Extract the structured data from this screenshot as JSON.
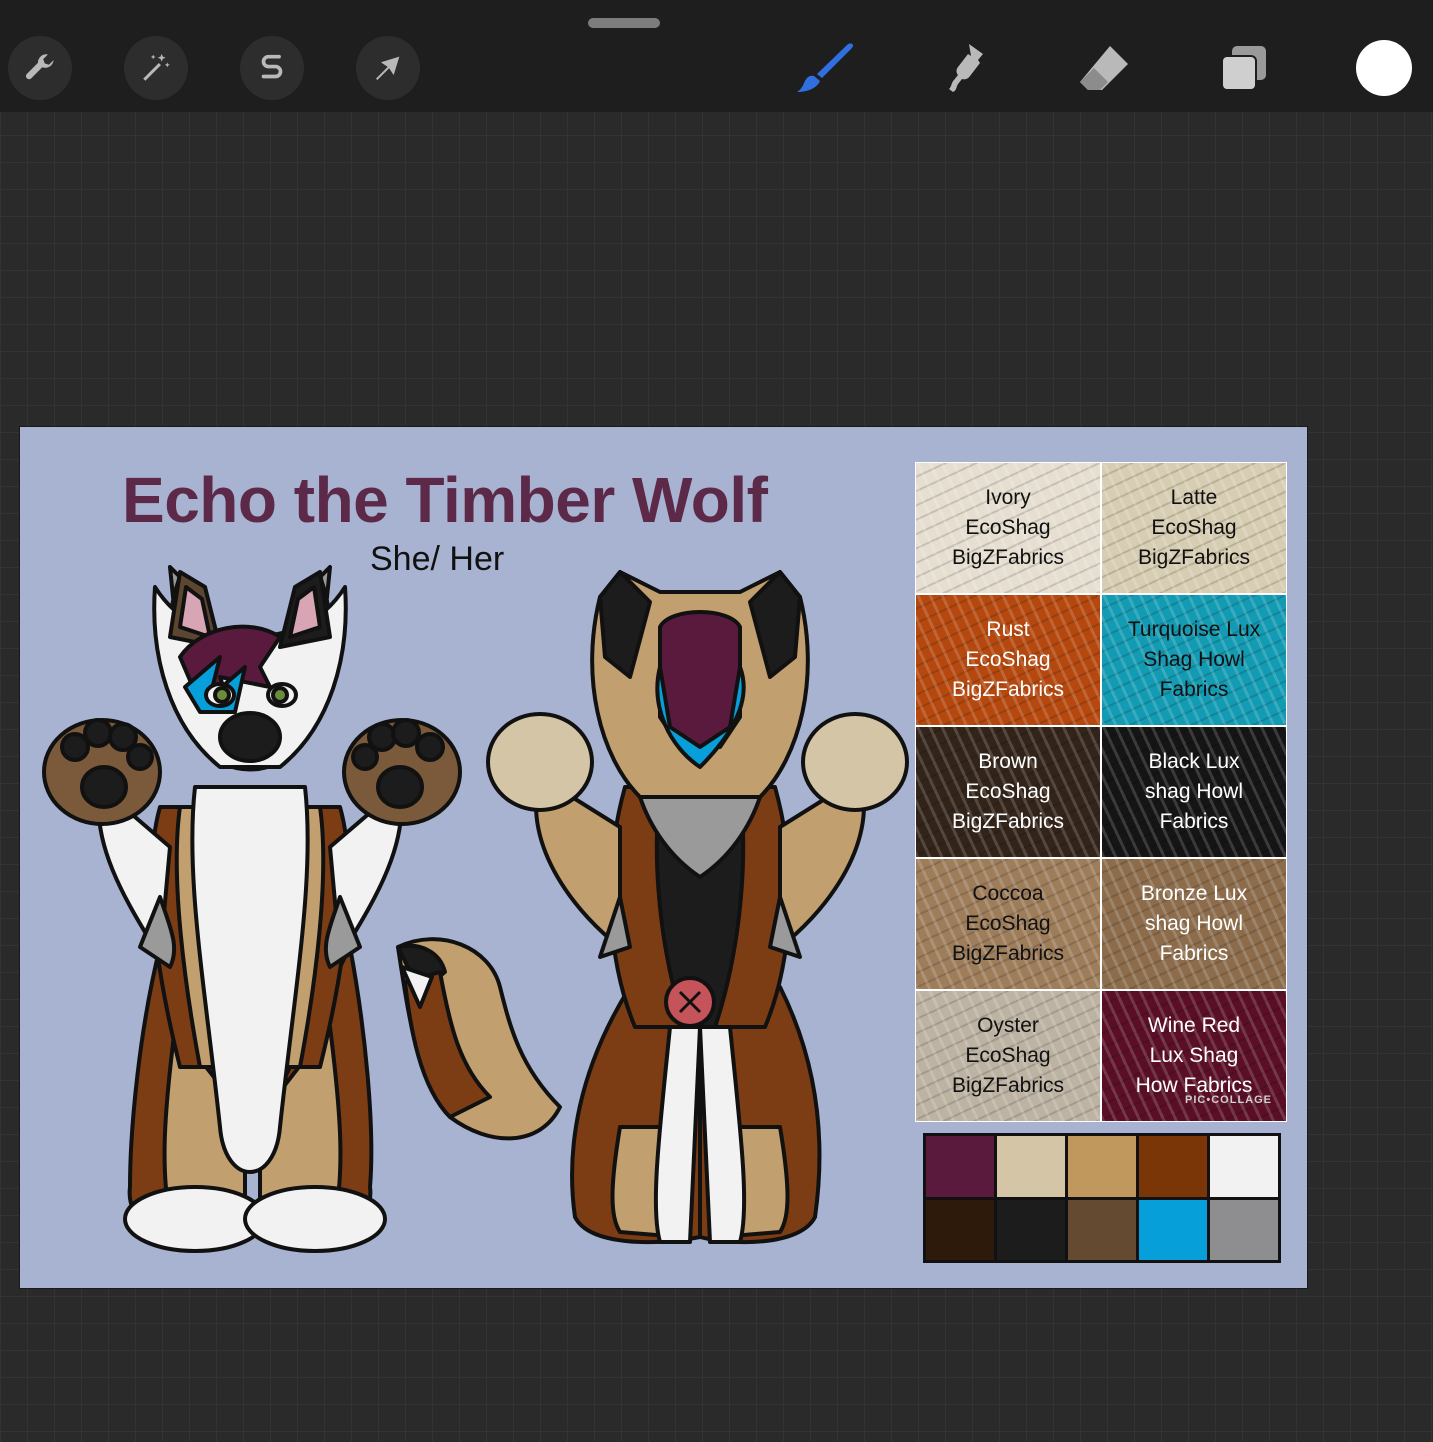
{
  "toolbar": {
    "left_tools": [
      {
        "name": "actions-wrench-icon"
      },
      {
        "name": "adjustments-wand-icon"
      },
      {
        "name": "selection-s-icon"
      },
      {
        "name": "transform-arrow-icon"
      }
    ],
    "right_tools": [
      {
        "name": "brush-icon",
        "color": "#2f6fe0",
        "active": true
      },
      {
        "name": "smudge-icon",
        "color": "#b9b9b9"
      },
      {
        "name": "eraser-icon",
        "color": "#b9b9b9"
      },
      {
        "name": "layers-icon",
        "color": "#b9b9b9"
      }
    ],
    "current_color": "#ffffff"
  },
  "sheet": {
    "title": "Echo the Timber Wolf",
    "pronouns": "She/ Her",
    "background": "#a7b3d1"
  },
  "fabric_swatches": [
    {
      "label": "Ivory\nEcoShag\nBigZFabrics",
      "color": "#e6dfd1",
      "text_color": "#111111"
    },
    {
      "label": "Latte\nEcoShag\nBigZFabrics",
      "color": "#d7cdb2",
      "text_color": "#111111"
    },
    {
      "label": "Rust\nEcoShag\nBigZFabrics",
      "color": "#b5480e",
      "text_color": "#ffffff"
    },
    {
      "label": "Turquoise Lux\nShag Howl\nFabrics",
      "color": "#129bb3",
      "text_color": "#111111"
    },
    {
      "label": "Brown\nEcoShag\nBigZFabrics",
      "color": "#33241a",
      "text_color": "#ffffff"
    },
    {
      "label": "Black Lux\nshag Howl\nFabrics",
      "color": "#151515",
      "text_color": "#ffffff"
    },
    {
      "label": "Coccoa\nEcoShag\nBigZFabrics",
      "color": "#9e7d5b",
      "text_color": "#111111"
    },
    {
      "label": "Bronze Lux\nshag Howl\nFabrics",
      "color": "#8c6c4b",
      "text_color": "#ffffff"
    },
    {
      "label": "Oyster\nEcoShag\nBigZFabrics",
      "color": "#bdb3a3",
      "text_color": "#111111"
    },
    {
      "label": "Wine Red\nLux Shag\nHow Fabrics",
      "color": "#5a0f27",
      "text_color": "#ffffff"
    }
  ],
  "watermark": "PIC•COLLAGE",
  "palette": [
    "#5a1a3e",
    "#d4c5a6",
    "#c0985e",
    "#7a3607",
    "#f2f2f2",
    "#2e1a0a",
    "#1c1c1c",
    "#654a32",
    "#069fd9",
    "#8e8e90"
  ]
}
